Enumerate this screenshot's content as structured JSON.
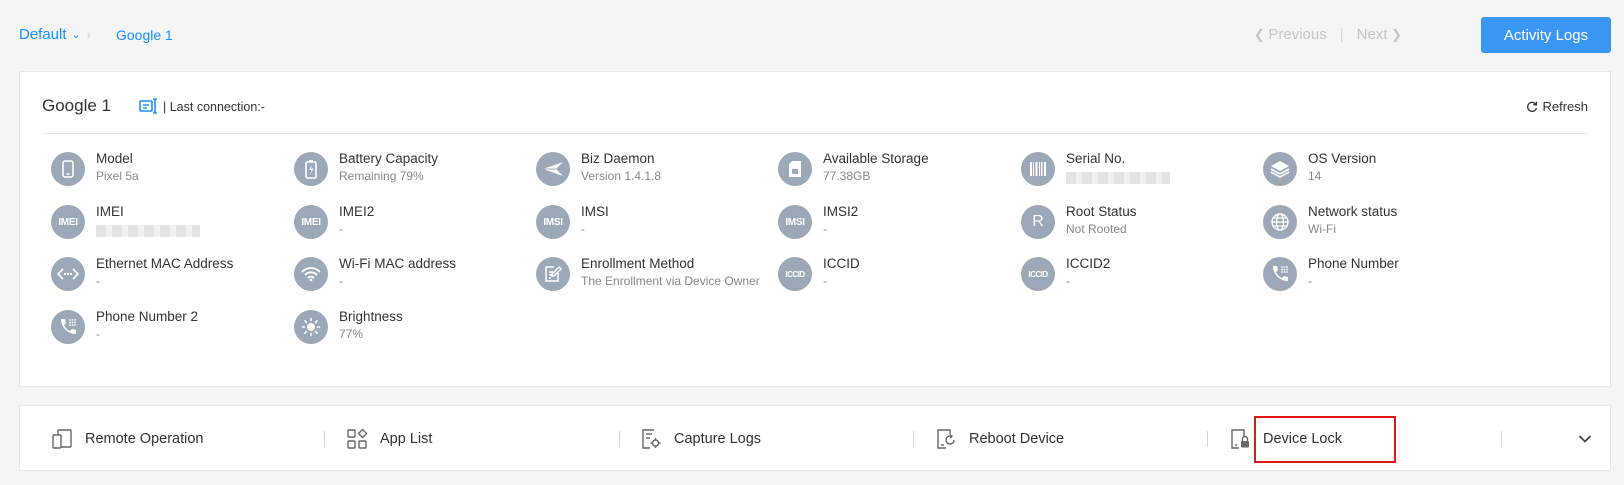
{
  "breadcrumb": {
    "group": "Default",
    "current": "Google 1"
  },
  "pager": {
    "previous_label": "Previous",
    "separator": "|",
    "next_label": "Next"
  },
  "header_button": {
    "label": "Activity Logs"
  },
  "device": {
    "name": "Google 1",
    "last_connection": "| Last connection:-",
    "refresh_label": "Refresh"
  },
  "info": [
    {
      "label": "Model",
      "value": "Pixel 5a",
      "icon": "phone-icon"
    },
    {
      "label": "Battery Capacity",
      "value": "Remaining 79%",
      "icon": "battery-icon"
    },
    {
      "label": "Biz Daemon",
      "value": "Version 1.4.1.8",
      "icon": "paper-plane-icon"
    },
    {
      "label": "Available Storage",
      "value": "77.38GB",
      "icon": "sd-card-icon"
    },
    {
      "label": "Serial No.",
      "value": "",
      "icon": "barcode-icon"
    },
    {
      "label": "OS Version",
      "value": "14",
      "icon": "layers-icon"
    },
    {
      "label": "IMEI",
      "value": "",
      "icon": "imei-icon"
    },
    {
      "label": "IMEI2",
      "value": "-",
      "icon": "imei2-icon"
    },
    {
      "label": "IMSI",
      "value": "-",
      "icon": "imsi-icon"
    },
    {
      "label": "IMSI2",
      "value": "-",
      "icon": "imsi2-icon"
    },
    {
      "label": "Root Status",
      "value": "Not Rooted",
      "icon": "root-icon"
    },
    {
      "label": "Network status",
      "value": "Wi-Fi",
      "icon": "globe-icon"
    },
    {
      "label": "Ethernet MAC Address",
      "value": "-",
      "icon": "ethernet-icon"
    },
    {
      "label": "Wi-Fi MAC address",
      "value": "-",
      "icon": "wifi-icon"
    },
    {
      "label": "Enrollment Method",
      "value": "The Enrollment via Device Owner",
      "icon": "edit-document-icon"
    },
    {
      "label": "ICCID",
      "value": "-",
      "icon": "iccid-icon"
    },
    {
      "label": "ICCID2",
      "value": "-",
      "icon": "iccid2-icon"
    },
    {
      "label": "Phone Number",
      "value": "-",
      "icon": "phone-dial-icon"
    },
    {
      "label": "Phone Number 2",
      "value": "-",
      "icon": "phone-dial-2-icon"
    },
    {
      "label": "Brightness",
      "value": "77%",
      "icon": "sun-icon"
    }
  ],
  "icon_text": {
    "imei": "IMEI",
    "imsi": "IMSI",
    "iccid": "ICCID",
    "root": "R"
  },
  "actions": [
    {
      "label": "Remote Operation",
      "icon": "remote-operation-icon"
    },
    {
      "label": "App List",
      "icon": "app-list-icon"
    },
    {
      "label": "Capture Logs",
      "icon": "capture-logs-icon"
    },
    {
      "label": "Reboot Device",
      "icon": "reboot-icon"
    },
    {
      "label": "Device Lock",
      "icon": "device-lock-icon"
    }
  ],
  "colors": {
    "accent": "#1890ff",
    "primary_button": "#3a96f3",
    "icon_circle": "#9aa8b8",
    "highlight": "#e01818"
  }
}
